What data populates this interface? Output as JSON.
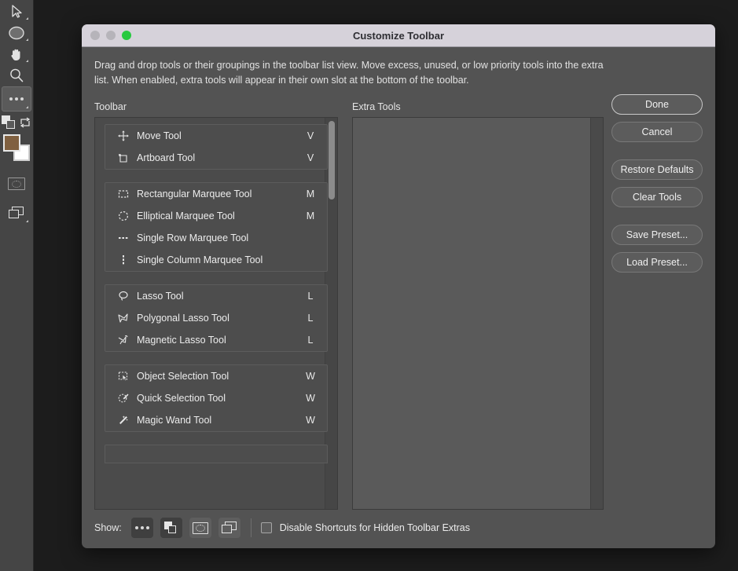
{
  "app_toolbar": {
    "items": [
      {
        "name": "move-cursor-tool",
        "icon": "cursor-icon"
      },
      {
        "name": "ellipse-tool",
        "icon": "ellipse-icon"
      },
      {
        "name": "hand-tool",
        "icon": "hand-icon"
      },
      {
        "name": "zoom-tool",
        "icon": "magnifier-icon"
      },
      {
        "name": "edit-toolbar-tool",
        "icon": "ellipsis-icon"
      },
      {
        "name": "swap-colors",
        "icon": "swap-colors-icon"
      },
      {
        "name": "quick-mask-mode",
        "icon": "quick-mask-icon"
      },
      {
        "name": "screen-mode",
        "icon": "screen-mode-icon"
      }
    ],
    "foreground_color": "#806040",
    "background_color": "#ffffff"
  },
  "window": {
    "title": "Customize Toolbar",
    "traffic_lights": [
      "close",
      "minimize",
      "zoom"
    ]
  },
  "description": "Drag and drop tools or their groupings in the toolbar list view. Move excess, unused, or low priority tools into the extra list. When enabled, extra tools will appear in their own slot at the bottom of the toolbar.",
  "columns": {
    "toolbar_label": "Toolbar",
    "extra_label": "Extra Tools"
  },
  "toolbar_groups": [
    {
      "tools": [
        {
          "name": "Move Tool",
          "shortcut": "V",
          "icon": "move-icon"
        },
        {
          "name": "Artboard Tool",
          "shortcut": "V",
          "icon": "artboard-icon"
        }
      ]
    },
    {
      "tools": [
        {
          "name": "Rectangular Marquee Tool",
          "shortcut": "M",
          "icon": "rectangular-marquee-icon"
        },
        {
          "name": "Elliptical Marquee Tool",
          "shortcut": "M",
          "icon": "elliptical-marquee-icon"
        },
        {
          "name": "Single Row Marquee Tool",
          "shortcut": "",
          "icon": "single-row-marquee-icon"
        },
        {
          "name": "Single Column Marquee Tool",
          "shortcut": "",
          "icon": "single-column-marquee-icon"
        }
      ]
    },
    {
      "tools": [
        {
          "name": "Lasso Tool",
          "shortcut": "L",
          "icon": "lasso-icon"
        },
        {
          "name": "Polygonal Lasso Tool",
          "shortcut": "L",
          "icon": "polygonal-lasso-icon"
        },
        {
          "name": "Magnetic Lasso Tool",
          "shortcut": "L",
          "icon": "magnetic-lasso-icon"
        }
      ]
    },
    {
      "tools": [
        {
          "name": "Object Selection Tool",
          "shortcut": "W",
          "icon": "object-selection-icon"
        },
        {
          "name": "Quick Selection Tool",
          "shortcut": "W",
          "icon": "quick-selection-icon"
        },
        {
          "name": "Magic Wand Tool",
          "shortcut": "W",
          "icon": "magic-wand-icon"
        }
      ]
    }
  ],
  "extra_tools": [],
  "buttons": [
    {
      "label": "Done",
      "primary": true
    },
    {
      "label": "Cancel",
      "primary": false
    },
    {
      "label": "Restore Defaults",
      "primary": false
    },
    {
      "label": "Clear Tools",
      "primary": false
    },
    {
      "label": "Save Preset...",
      "primary": false
    },
    {
      "label": "Load Preset...",
      "primary": false
    }
  ],
  "bottom_bar": {
    "show_label": "Show:",
    "toggles": [
      {
        "name": "extras-toggle",
        "icon": "ellipsis-icon",
        "active": true
      },
      {
        "name": "colors-toggle",
        "icon": "color-swatches-icon",
        "active": true
      },
      {
        "name": "quick-mask-toggle",
        "icon": "quick-mask-icon",
        "active": false
      },
      {
        "name": "screen-mode-toggle",
        "icon": "screen-mode-icon",
        "active": false
      }
    ],
    "checkbox_label": "Disable Shortcuts for Hidden Toolbar Extras",
    "checkbox_checked": false
  }
}
